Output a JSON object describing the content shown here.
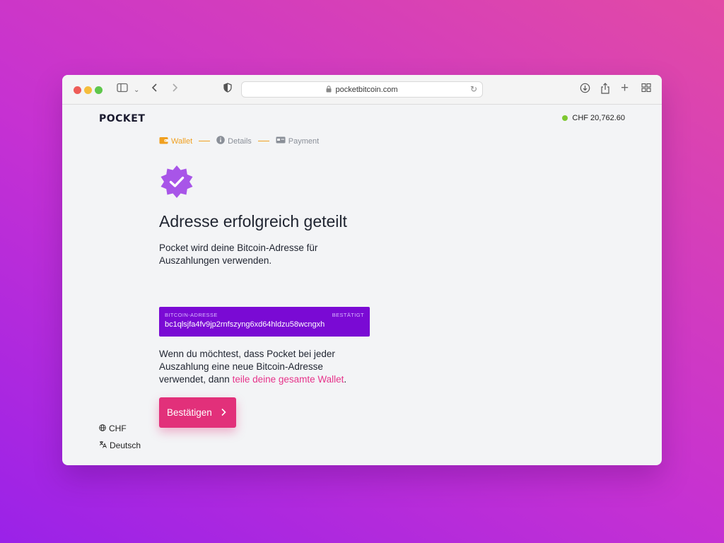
{
  "browser": {
    "url": "pocketbitcoin.com",
    "icons": {
      "sidebar": "sidebar-icon",
      "back": "chevron-left-icon",
      "forward": "chevron-right-icon",
      "shield": "shield-icon",
      "download": "download-icon",
      "share": "share-icon",
      "new_tab": "plus-icon",
      "tab_overview": "grid-icon",
      "reload": "reload-icon",
      "lock": "lock-icon"
    }
  },
  "header": {
    "logo": "POCKET",
    "balance": "CHF 20,762.60",
    "status_color": "#7ec831"
  },
  "steps": [
    {
      "label": "Wallet",
      "icon": "wallet-icon",
      "active": true
    },
    {
      "label": "Details",
      "icon": "info-icon",
      "active": false
    },
    {
      "label": "Payment",
      "icon": "payment-icon",
      "active": false
    }
  ],
  "main": {
    "title": "Adresse erfolgreich geteilt",
    "intro": "Pocket wird deine Bitcoin-Adresse für Auszahlungen verwenden.",
    "address_box": {
      "label": "BITCOIN-ADRESSE",
      "status": "BESTÄTIGT",
      "value": "bc1qlsjfa4fv9jp2rnfszyng6xd64hldzu58wcngxh",
      "color": "#7a0ad4"
    },
    "note_text": "Wenn du möchtest, dass Pocket bei jeder Auszahlung eine neue Bitcoin-Adresse verwendet, dann ",
    "note_link": "teile deine gesamte Wallet",
    "note_end": ".",
    "confirm_label": "Bestätigen",
    "accent": "#e2307a"
  },
  "footer": {
    "currency": "CHF",
    "language": "Deutsch"
  }
}
